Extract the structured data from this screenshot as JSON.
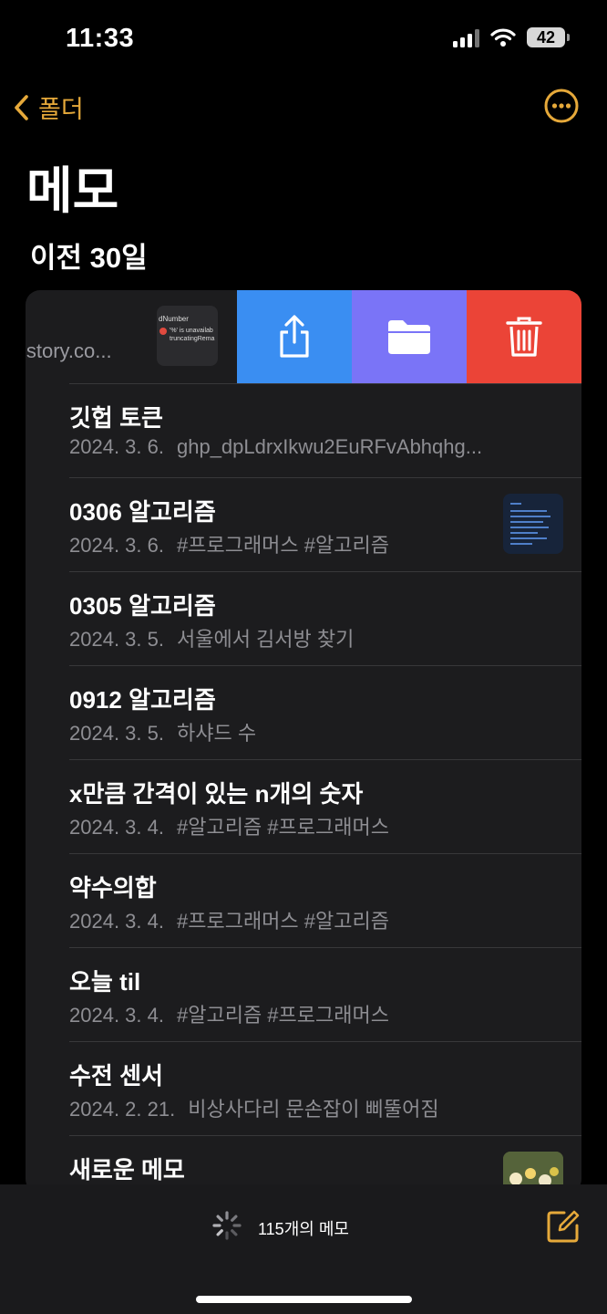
{
  "status_bar": {
    "time": "11:33",
    "battery": "42"
  },
  "nav": {
    "back_label": "폴더"
  },
  "page_title": "메모",
  "section_header": "이전 30일",
  "swiped_note": {
    "snippet": "istory.co...",
    "thumb_line1": "dNumber",
    "thumb_line2": "'%' is unavailab",
    "thumb_line3": "truncatingRema"
  },
  "swipe_actions": [
    "share",
    "move-to-folder",
    "delete"
  ],
  "notes": [
    {
      "title": "깃헙 토큰",
      "date": "2024. 3. 6.",
      "preview": "ghp_dpLdrxIkwu2EuRFvAbhqhg...",
      "thumbnail": ""
    },
    {
      "title": "0306 알고리즘",
      "date": "2024. 3. 6.",
      "preview": "#프로그래머스 #알고리즘",
      "thumbnail": "code-screenshot"
    },
    {
      "title": "0305 알고리즘",
      "date": "2024. 3. 5.",
      "preview": "서울에서 김서방 찾기",
      "thumbnail": ""
    },
    {
      "title": "0912 알고리즘",
      "date": "2024. 3. 5.",
      "preview": "하샤드 수",
      "thumbnail": ""
    },
    {
      "title": "x만큼 간격이 있는 n개의 숫자",
      "date": "2024. 3. 4.",
      "preview": "#알고리즘 #프로그래머스",
      "thumbnail": ""
    },
    {
      "title": "약수의합",
      "date": "2024. 3. 4.",
      "preview": "#프로그래머스 #알고리즘",
      "thumbnail": ""
    },
    {
      "title": "오늘 til",
      "date": "2024. 3. 4.",
      "preview": "#알고리즘 #프로그래머스",
      "thumbnail": ""
    },
    {
      "title": "수전 센서",
      "date": "2024. 2. 21.",
      "preview": "비상사다리 문손잡이 삐뚤어짐",
      "thumbnail": ""
    },
    {
      "title": "새로운 메모",
      "date": "",
      "preview": "",
      "thumbnail": "flower-photo"
    }
  ],
  "toolbar": {
    "count_label": "115개의 메모"
  },
  "colors": {
    "accent": "#e6a93a",
    "share": "#3a8ef2",
    "folder": "#7a74f7",
    "delete": "#eb4437",
    "card": "#1c1c1e"
  }
}
